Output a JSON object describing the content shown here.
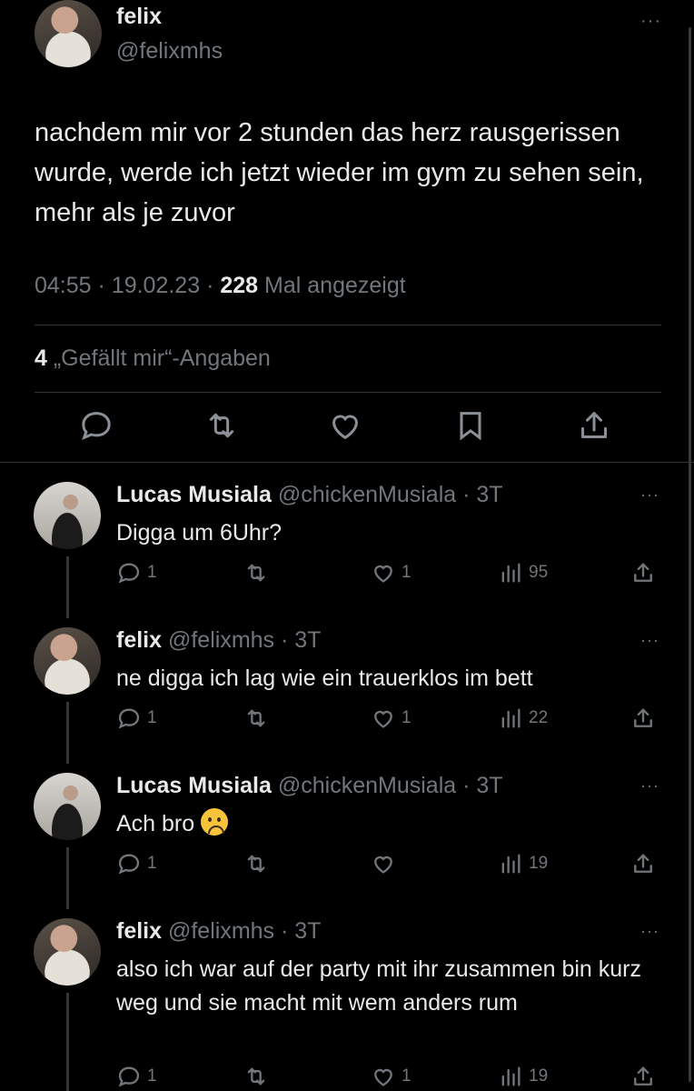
{
  "main_tweet": {
    "name": "felix",
    "handle": "@felixmhs",
    "more": "···",
    "text": "nachdem mir vor 2 stunden das herz rausgerissen wurde, werde ich jetzt wieder im gym zu sehen sein, mehr als je zuvor",
    "time": "04:55",
    "date": "19.02.23",
    "views": "228",
    "views_label": "Mal angezeigt",
    "likes": "4",
    "likes_label": "„Gefällt mir“-Angaben"
  },
  "replies": [
    {
      "name": "Lucas Musiala",
      "handle_time": "@chickenMusiala · 3T",
      "text": "Digga um 6Uhr?",
      "replies": "1",
      "retweets": "",
      "likes": "1",
      "views": "95"
    },
    {
      "name": "felix",
      "handle_time": "@felixmhs · 3T",
      "text": "ne digga ich lag wie ein trauerklos im bett",
      "replies": "1",
      "retweets": "",
      "likes": "1",
      "views": "22"
    },
    {
      "name": "Lucas Musiala",
      "handle_time": "@chickenMusiala · 3T",
      "text": "Ach bro",
      "emoji": "sad-face-emoji",
      "replies": "1",
      "retweets": "",
      "likes": "",
      "views": "19"
    },
    {
      "name": "felix",
      "handle_time": "@felixmhs · 3T",
      "text": "also ich war auf der party mit ihr zusammen bin kurz weg und sie macht mit wem anders rum",
      "replies": "1",
      "retweets": "",
      "likes": "1",
      "views": "19"
    }
  ],
  "colors": {
    "background": "#000000",
    "text": "#e7e9ea",
    "secondary": "#71767b",
    "divider": "#2f3336"
  }
}
